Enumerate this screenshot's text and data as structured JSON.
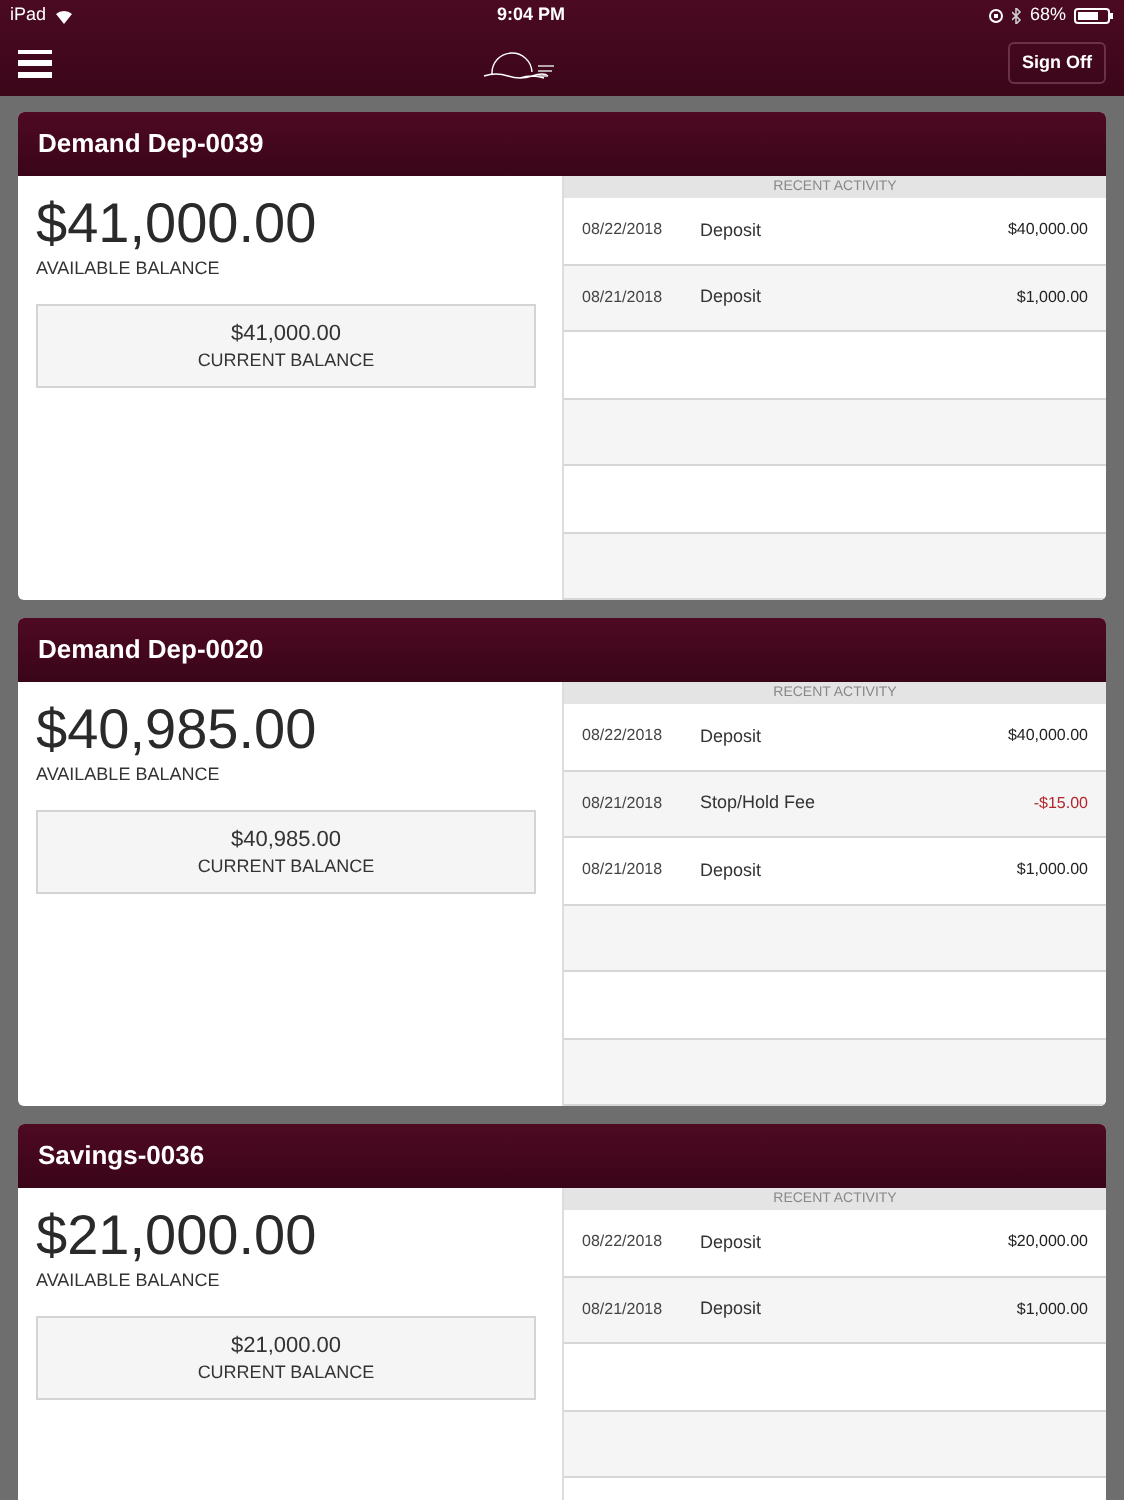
{
  "status_bar": {
    "device": "iPad",
    "time": "9:04 PM",
    "battery": "68%"
  },
  "nav": {
    "sign_off": "Sign Off"
  },
  "accounts": [
    {
      "name": "Demand Dep-0039",
      "available": "$41,000.00",
      "available_label": "AVAILABLE BALANCE",
      "current": "$41,000.00",
      "current_label": "CURRENT BALANCE",
      "activity_title": "RECENT ACTIVITY",
      "activity": [
        {
          "date": "08/22/2018",
          "description": "Deposit",
          "amount": "$40,000.00",
          "kind": "credit"
        },
        {
          "date": "08/21/2018",
          "description": "Deposit",
          "amount": "$1,000.00",
          "kind": "credit"
        }
      ]
    },
    {
      "name": "Demand Dep-0020",
      "available": "$40,985.00",
      "available_label": "AVAILABLE BALANCE",
      "current": "$40,985.00",
      "current_label": "CURRENT BALANCE",
      "activity_title": "RECENT ACTIVITY",
      "activity": [
        {
          "date": "08/22/2018",
          "description": "Deposit",
          "amount": "$40,000.00",
          "kind": "credit"
        },
        {
          "date": "08/21/2018",
          "description": "Stop/Hold Fee",
          "amount": "-$15.00",
          "kind": "debit"
        },
        {
          "date": "08/21/2018",
          "description": "Deposit",
          "amount": "$1,000.00",
          "kind": "credit"
        }
      ]
    },
    {
      "name": "Savings-0036",
      "available": "$21,000.00",
      "available_label": "AVAILABLE BALANCE",
      "current": "$21,000.00",
      "current_label": "CURRENT BALANCE",
      "activity_title": "RECENT ACTIVITY",
      "activity": [
        {
          "date": "08/22/2018",
          "description": "Deposit",
          "amount": "$20,000.00",
          "kind": "credit"
        },
        {
          "date": "08/21/2018",
          "description": "Deposit",
          "amount": "$1,000.00",
          "kind": "credit"
        }
      ]
    }
  ]
}
